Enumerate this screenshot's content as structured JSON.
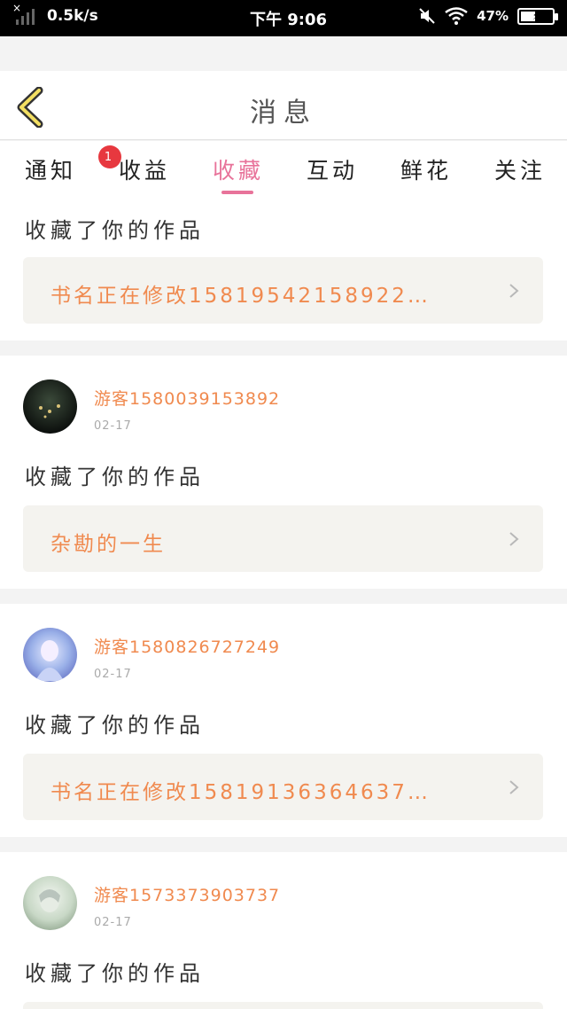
{
  "status_bar": {
    "x_mark": "×",
    "speed": "0.5k/s",
    "time": "下午 9:06",
    "battery": "47%"
  },
  "header": {
    "title": "消息",
    "back_icon": "chevron-left-icon"
  },
  "tabs": [
    {
      "label": "通知",
      "badge": "1"
    },
    {
      "label": "收益"
    },
    {
      "label": "收藏",
      "active": true
    },
    {
      "label": "互动"
    },
    {
      "label": "鲜花"
    },
    {
      "label": "关注"
    }
  ],
  "colors": {
    "accent": "#e8739a",
    "username": "#f08a4f",
    "badge": "#e7383f",
    "work_box_bg": "#f4f3ef"
  },
  "messages": [
    {
      "action": "收藏了你的作品",
      "work_title": "书名正在修改15819542158922…"
    },
    {
      "username": "游客1580039153892",
      "date": "02-17",
      "action": "收藏了你的作品",
      "work_title": "杂勘的一生"
    },
    {
      "username": "游客1580826727249",
      "date": "02-17",
      "action": "收藏了你的作品",
      "work_title": "书名正在修改15819136364637…"
    },
    {
      "username": "游客1573373903737",
      "date": "02-17",
      "action": "收藏了你的作品"
    }
  ]
}
